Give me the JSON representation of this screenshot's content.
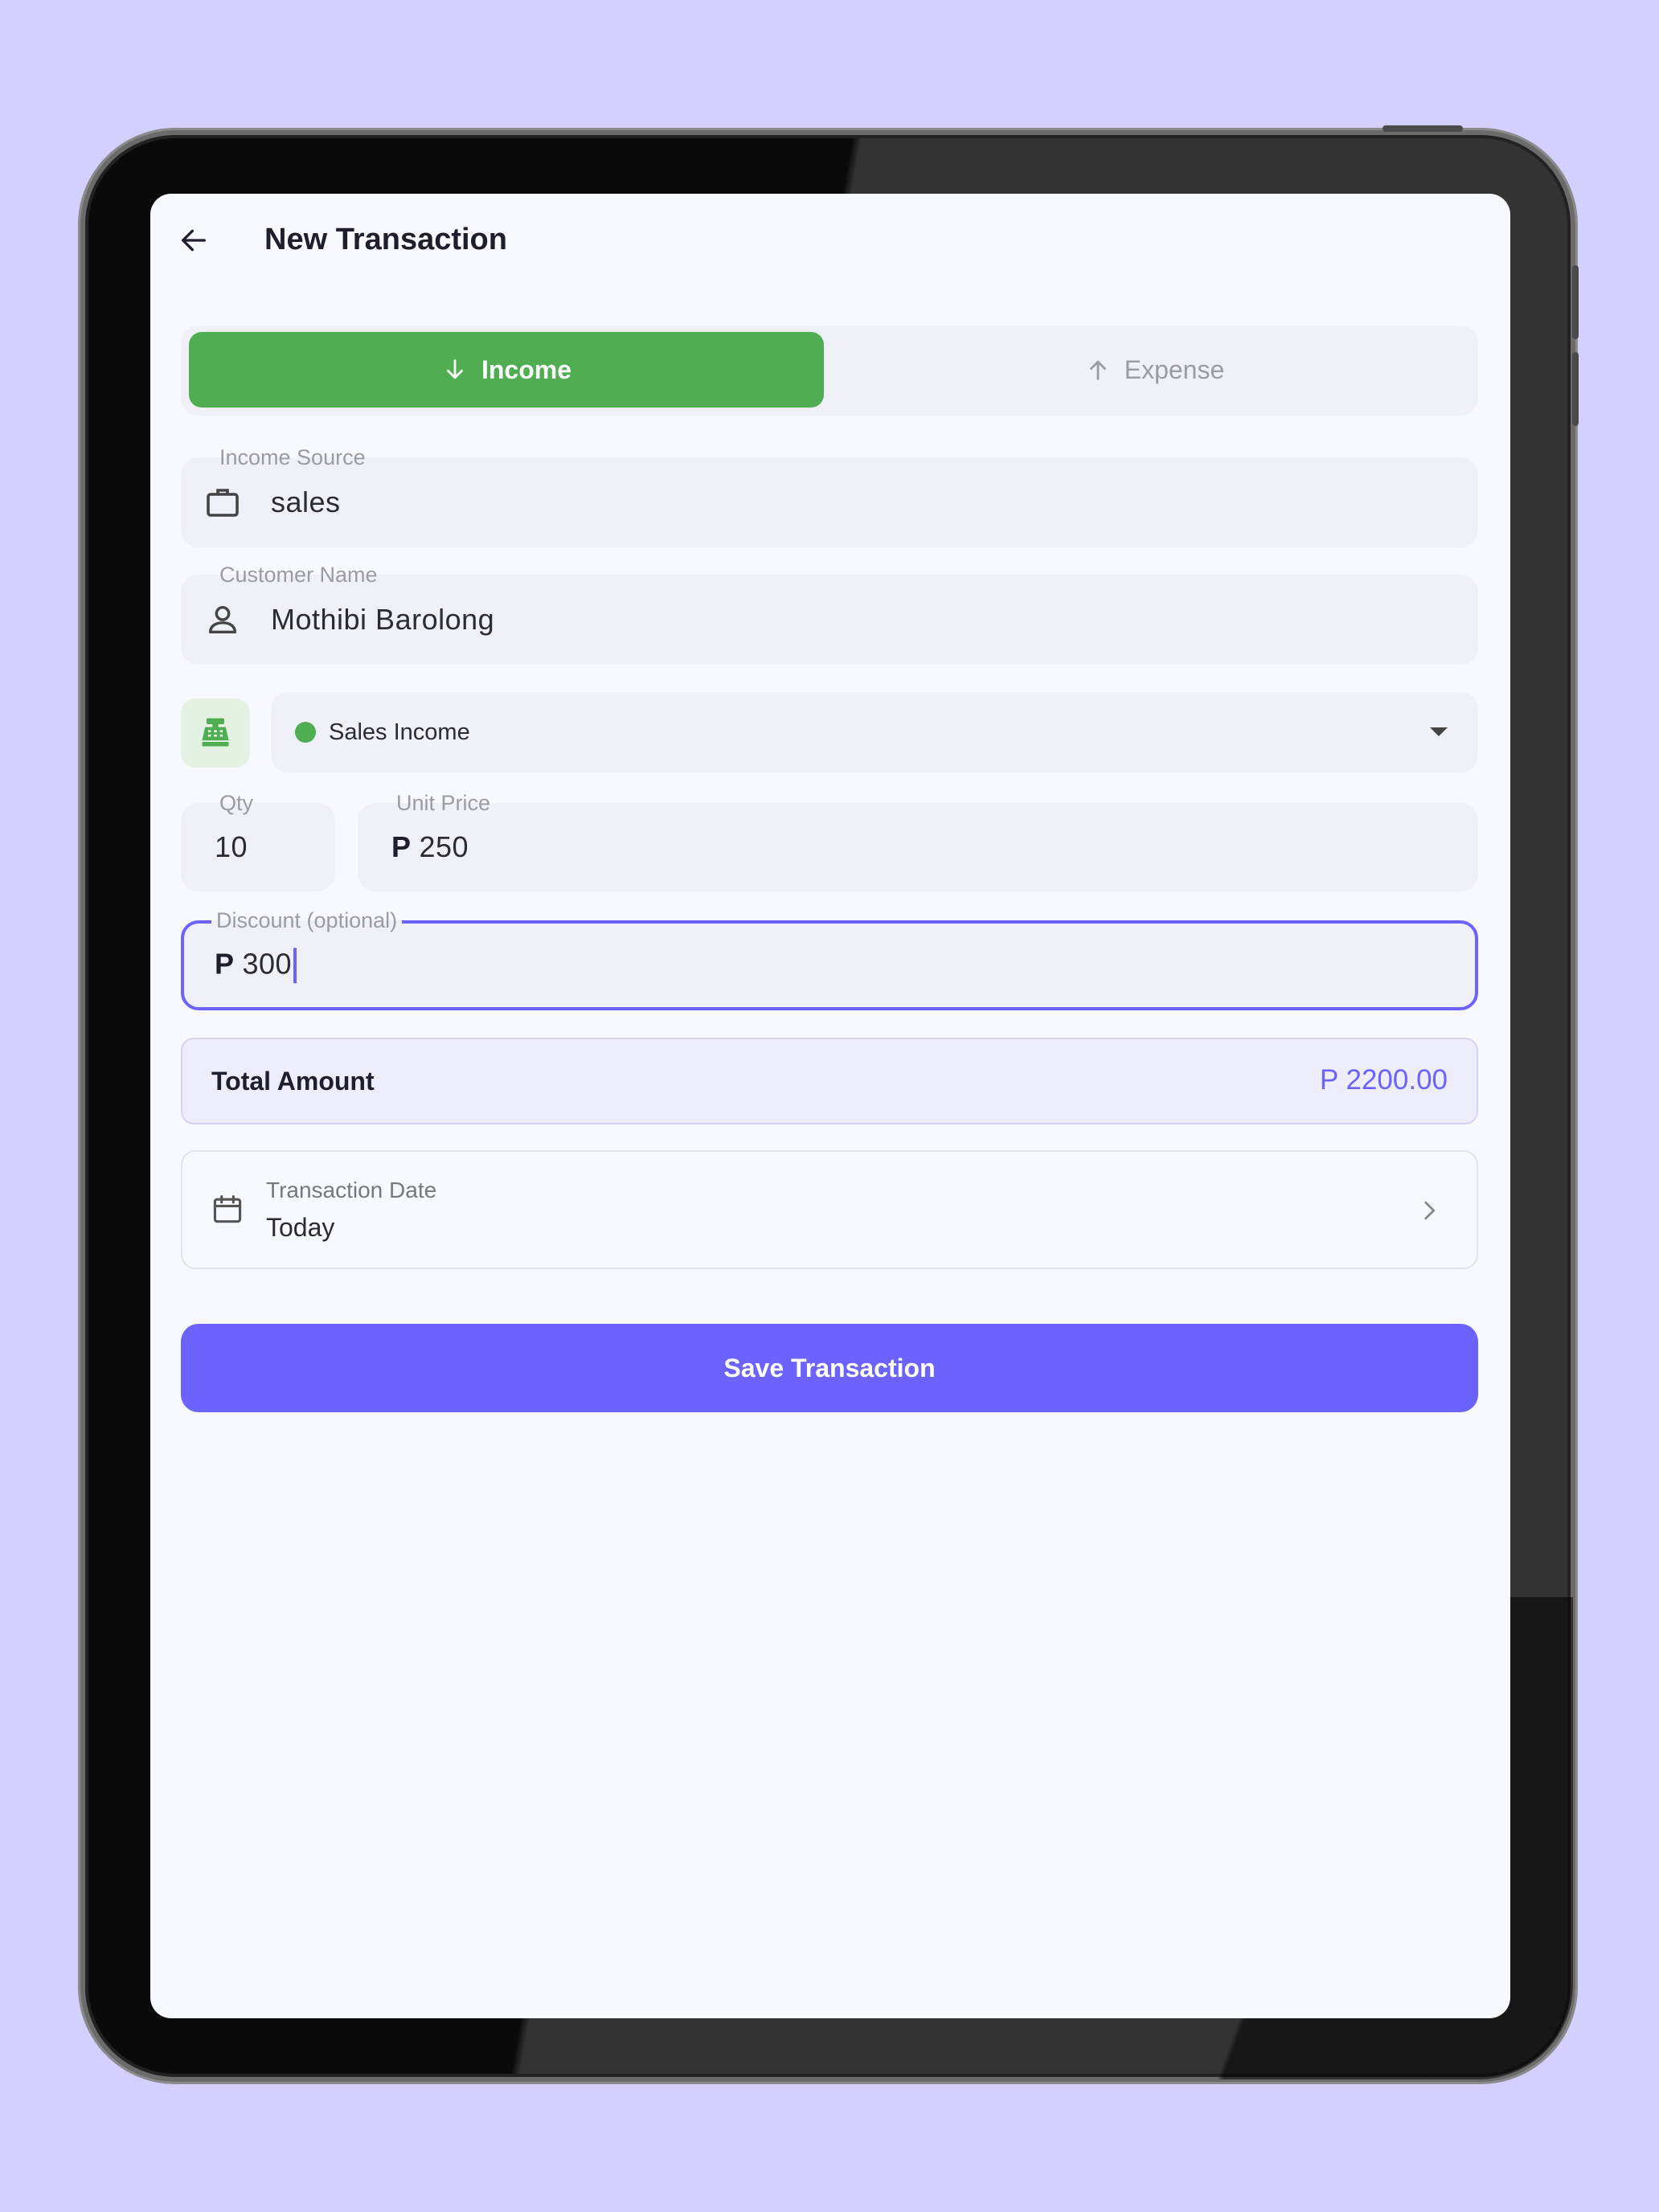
{
  "header": {
    "title": "New Transaction",
    "back_icon": "arrow-left-icon"
  },
  "type_toggle": {
    "income_label": "Income",
    "income_icon": "arrow-down-icon",
    "expense_label": "Expense",
    "expense_icon": "arrow-up-icon",
    "selected": "Income"
  },
  "income_source": {
    "label": "Income Source",
    "value": "sales",
    "icon": "briefcase-icon"
  },
  "customer": {
    "label": "Customer Name",
    "value": "Mothibi Barolong",
    "icon": "person-icon"
  },
  "category": {
    "icon": "cash-register-icon",
    "selected": "Sales Income",
    "color": "#4FAE52"
  },
  "qty": {
    "label": "Qty",
    "value": "10"
  },
  "unit_price": {
    "label": "Unit Price",
    "currency": "P",
    "value": "250"
  },
  "discount": {
    "label": "Discount (optional)",
    "currency": "P",
    "value": "300"
  },
  "total": {
    "label": "Total Amount",
    "value": "P 2200.00"
  },
  "date": {
    "label": "Transaction Date",
    "value": "Today",
    "icon": "calendar-icon"
  },
  "save_label": "Save Transaction",
  "colors": {
    "background": "#D4D0FE",
    "accent": "#6C63FF",
    "income_green": "#4FAE52"
  }
}
